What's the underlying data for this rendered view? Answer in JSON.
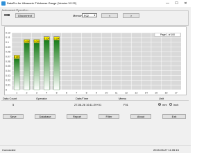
{
  "window": {
    "title": "DataPro for Ultrasonic Thickness Gauge (Version V2.22)",
    "minimize": "—",
    "maximize": "☐",
    "close": "✕"
  },
  "instrument": {
    "group_label": "Instrument Operation",
    "disconnect_label": "Disconnect",
    "memory_label": "Memory:",
    "memory_value": "F02",
    "prev_label": "<",
    "next_label": ">",
    "usb_icon": "usb-icon"
  },
  "chart_data": {
    "type": "bar",
    "page_label": "Page 1 of 100",
    "categories": [
      "1",
      "2",
      "3",
      "4",
      "5",
      "6",
      "7",
      "8",
      "9",
      "10",
      "11",
      "12",
      "13",
      "14",
      "15",
      "16",
      "17"
    ],
    "values": [
      0.065,
      0.098,
      0.098,
      0.104,
      0.104,
      0,
      0,
      0,
      0,
      0,
      0,
      0,
      0,
      0,
      0,
      0,
      0
    ],
    "data_labels": [
      "0.065",
      "0.098",
      "0.098",
      "0.104",
      "0.104"
    ],
    "yticks": [
      "0.12",
      "0.11",
      "0.1",
      "0.09",
      "0.08",
      "0.07",
      "0.06",
      "0.05",
      "0.04",
      "0.03",
      "0.02",
      "0.01",
      "0"
    ],
    "ylim": [
      0,
      0.12
    ],
    "grid": true,
    "bar_colors": {
      "top": "#1a7d1a",
      "bottom": "#ffffff"
    },
    "label_color": "#fff200"
  },
  "info": {
    "count_label": "Data Count",
    "count_value": "5",
    "operator_label": "Operator",
    "operator_value": "",
    "datetime_label": "Date/Time",
    "datetime_value": "27-06-26 16:11:29+01",
    "memo_label": "Memo",
    "memo_value": "F01",
    "unit_label": "Unit",
    "unit_mm": "mm",
    "unit_inch": "inch",
    "unit_selected": "mm"
  },
  "toolbar": {
    "save": "Save",
    "database": "Database",
    "report": "Report",
    "filter": "Filter",
    "about": "About",
    "exit": "Exit"
  },
  "status": {
    "left": "Connected",
    "right": "2019-05-27 11:05:15"
  }
}
